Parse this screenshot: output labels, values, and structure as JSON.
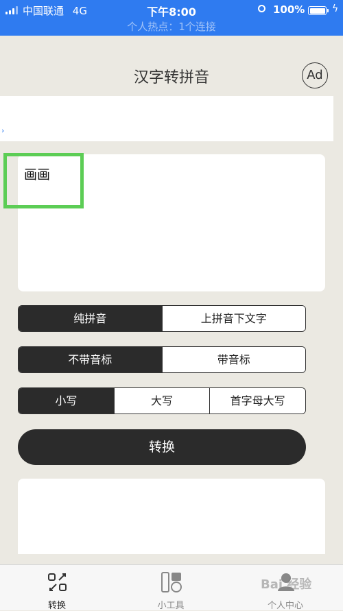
{
  "status_bar": {
    "carrier": "中国联通",
    "network": "4G",
    "time": "下午8:00",
    "battery": "100%",
    "hotspot": "个人热点：1个连接"
  },
  "nav": {
    "title": "汉字转拼音",
    "ad_label": "Ad"
  },
  "input": {
    "text": "画画"
  },
  "options": {
    "format": {
      "items": [
        "纯拼音",
        "上拼音下文字"
      ],
      "selected": "纯拼音"
    },
    "tone": {
      "items": [
        "不带音标",
        "带音标"
      ],
      "selected": "不带音标"
    },
    "case": {
      "items": [
        "小写",
        "大写",
        "首字母大写"
      ],
      "selected": "小写"
    }
  },
  "convert_label": "转换",
  "tabs": [
    {
      "label": "转换",
      "icon": "convert-icon",
      "active": true
    },
    {
      "label": "小工具",
      "icon": "tools-icon",
      "active": false
    },
    {
      "label": "个人中心",
      "icon": "profile-icon",
      "active": false
    }
  ],
  "watermark": "Bai 经验",
  "colors": {
    "status_bar": "#2f7bf0",
    "accent_dark": "#2b2b2b",
    "highlight": "#5ccd55",
    "background": "#ebe9e2"
  }
}
